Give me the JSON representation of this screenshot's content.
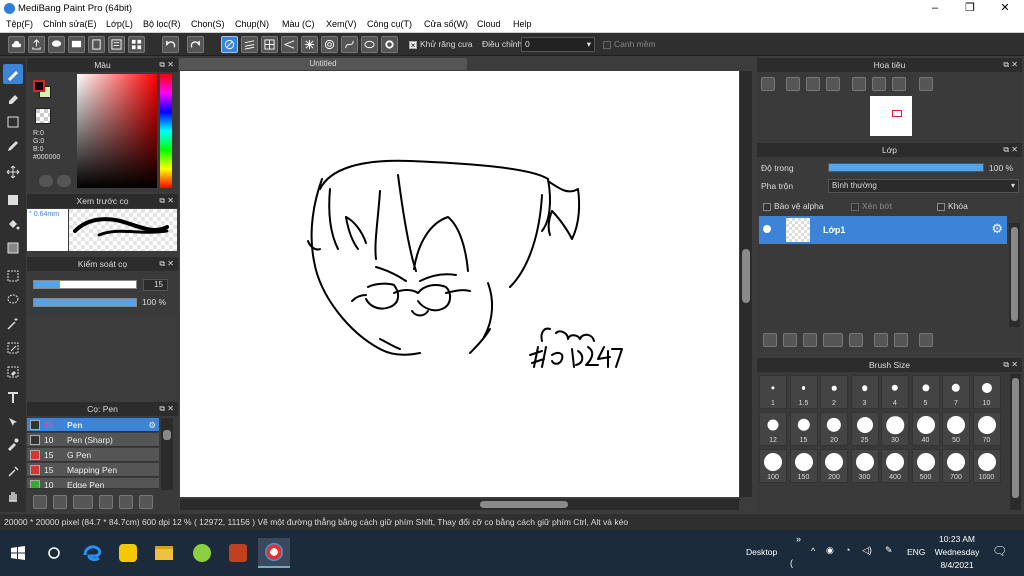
{
  "window": {
    "title": "MediBang Paint Pro (64bit)"
  },
  "menu": [
    "Tệp(F)",
    "Chỉnh sửa(E)",
    "Lớp(L)",
    "Bộ lọc(R)",
    "Chọn(S)",
    "Chụp(N)",
    "Màu (C)",
    "Xem(V)",
    "Công cụ(T)",
    "Cửa số(W)",
    "Cloud",
    "Help"
  ],
  "toolbar": {
    "antialias_label": "Khử răng cưa",
    "correction_label": "Điều chỉnh",
    "correction_value": "0",
    "snap_label": "Canh mềm"
  },
  "color_panel": {
    "title": "Màu",
    "r": "R:0",
    "g": "G:0",
    "b": "B:0",
    "hex": "#000000",
    "fg_color": "#000000",
    "accent": "#ff0000"
  },
  "brush_preview": {
    "title": "Xem trước cọ",
    "size": "0.64mm"
  },
  "brush_control": {
    "title": "Kiểm soát cọ",
    "size": "15",
    "size_fraction": 0.25,
    "opacity": "100 %",
    "opacity_fraction": 1.0
  },
  "brush_list": {
    "title": "Cọ: Pen",
    "items": [
      {
        "size": "15",
        "name": "Pen",
        "color": "#333333",
        "selected": true
      },
      {
        "size": "10",
        "name": "Pen (Sharp)",
        "color": "#333333",
        "selected": false
      },
      {
        "size": "15",
        "name": "G Pen",
        "color": "#e03030",
        "selected": false
      },
      {
        "size": "15",
        "name": "Mapping Pen",
        "color": "#e03030",
        "selected": false
      },
      {
        "size": "10",
        "name": "Edge Pen",
        "color": "#30b030",
        "selected": false
      }
    ]
  },
  "document": {
    "tab": "Untitled"
  },
  "navigator": {
    "title": "Hoa tiêu"
  },
  "layer_panel": {
    "title": "Lớp",
    "opacity_label": "Độ trong",
    "opacity_value": "100 %",
    "opacity_fraction": 1.0,
    "blend_label": "Pha trộn",
    "blend_value": "Bình thường",
    "protect_alpha": "Bảo vệ alpha",
    "clip": "Xén bớt",
    "lock": "Khóa",
    "layers": [
      {
        "name": "Lớp1"
      }
    ]
  },
  "brush_size": {
    "title": "Brush Size",
    "sizes": [
      "1",
      "1.5",
      "2",
      "3",
      "4",
      "5",
      "7",
      "10",
      "12",
      "15",
      "20",
      "25",
      "30",
      "40",
      "50",
      "70",
      "100",
      "150",
      "200",
      "300",
      "400",
      "500",
      "700",
      "1000"
    ]
  },
  "status": {
    "text": "20000 * 20000 pixel  (84.7 * 84.7cm)  600 dpi  12 %  ( 12972, 11156 )  Vẽ một đường thẳng bằng cách giữ phím Shift, Thay đổi cỡ cọ bằng cách giữ phím Ctrl, Alt và kéo"
  },
  "taskbar": {
    "desktop": "Desktop",
    "lang": "ENG",
    "time": "10:23 AM",
    "day": "Wednesday",
    "date": "8/4/2021"
  }
}
